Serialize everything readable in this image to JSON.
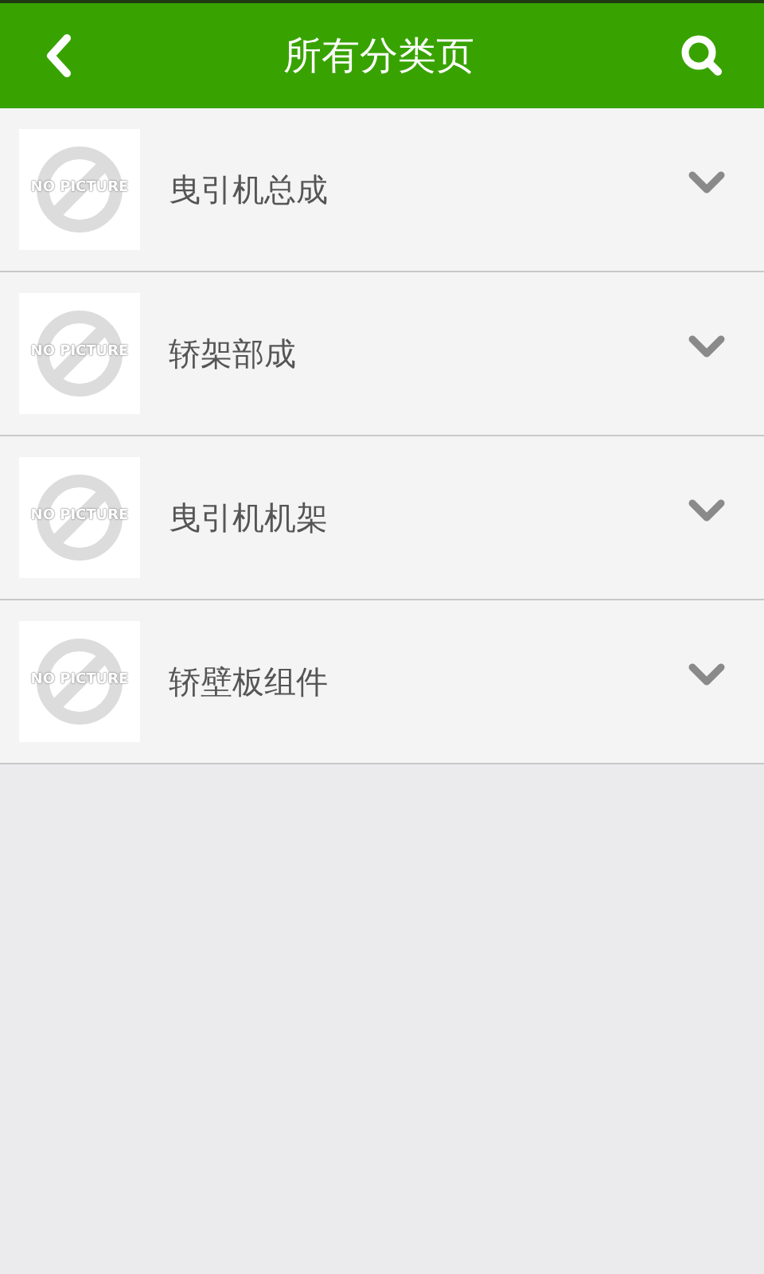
{
  "header": {
    "title": "所有分类页"
  },
  "categories": [
    {
      "name": "曳引机总成",
      "placeholder_text": "NO PICTURE",
      "expanded": false
    },
    {
      "name": "轿架部成",
      "placeholder_text": "NO PICTURE",
      "expanded": false
    },
    {
      "name": "曳引机机架",
      "placeholder_text": "NO PICTURE",
      "expanded": false
    },
    {
      "name": "轿壁板组件",
      "placeholder_text": "NO PICTURE",
      "expanded": false
    }
  ]
}
